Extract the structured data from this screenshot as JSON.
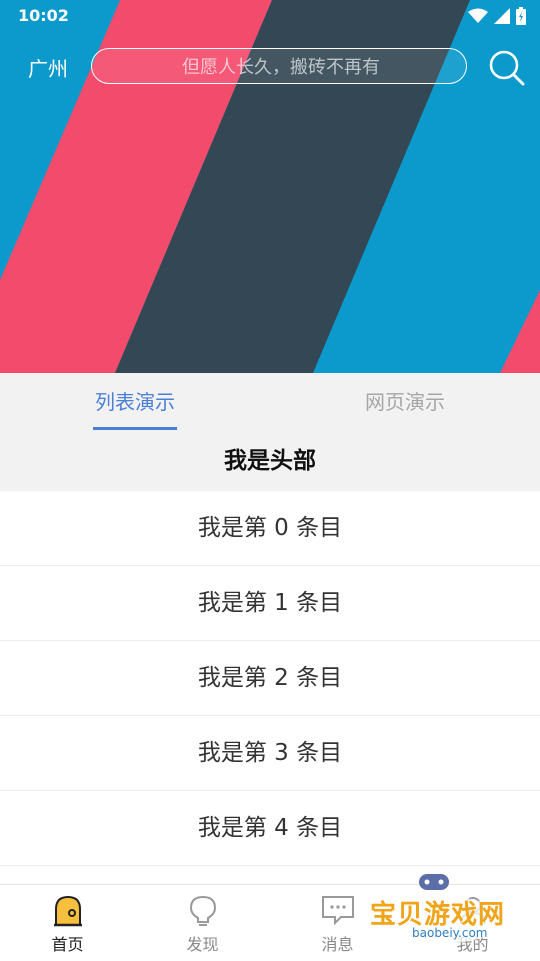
{
  "status_bar": {
    "time": "10:02"
  },
  "header": {
    "city": "广州",
    "search_placeholder": "但愿人长久，搬砖不再有"
  },
  "colors": {
    "banner_blue": "#0b9acb",
    "banner_red": "#f34b6c",
    "banner_dark": "#334854",
    "accent": "#4a7fd6"
  },
  "tabs": [
    {
      "label": "列表演示",
      "active": true
    },
    {
      "label": "网页演示",
      "active": false
    }
  ],
  "list_header": "我是头部",
  "list_items": [
    "我是第 0 条目",
    "我是第 1 条目",
    "我是第 2 条目",
    "我是第 3 条目",
    "我是第 4 条目"
  ],
  "bottom_nav": [
    {
      "label": "首页",
      "icon": "home-icon",
      "active": true
    },
    {
      "label": "发现",
      "icon": "lightbulb-icon",
      "active": false
    },
    {
      "label": "消息",
      "icon": "message-icon",
      "active": false
    },
    {
      "label": "我的",
      "icon": "profile-icon",
      "active": false
    }
  ],
  "watermark": {
    "title": "宝贝游戏网",
    "url": "baobeiy.com"
  }
}
